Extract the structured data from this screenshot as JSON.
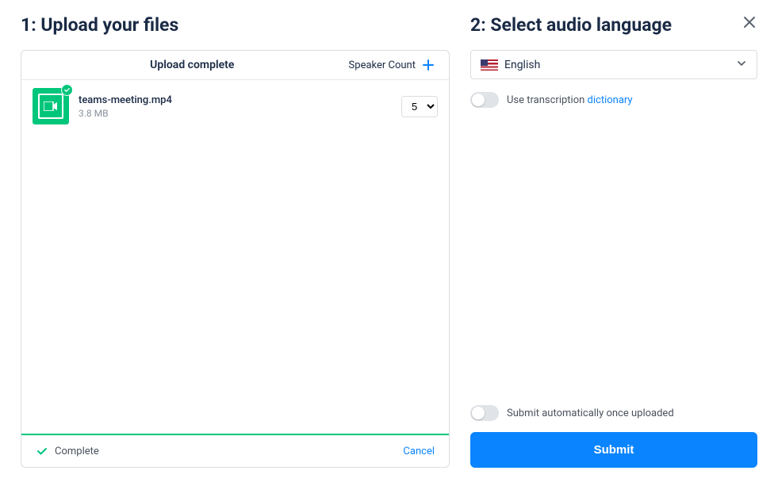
{
  "left": {
    "title": "1: Upload your files",
    "headerTitle": "Upload complete",
    "speakerCountLabel": "Speaker Count",
    "files": [
      {
        "name": "teams-meeting.mp4",
        "size": "3.8 MB",
        "speakerCount": "5"
      }
    ],
    "footer": {
      "completeText": "Complete",
      "cancelText": "Cancel"
    }
  },
  "right": {
    "title": "2: Select audio language",
    "language": "English",
    "dictionaryLabelPrefix": "Use transcription ",
    "dictionaryLink": "dictionary",
    "autoSubmitLabel": "Submit automatically once uploaded",
    "submitLabel": "Submit"
  }
}
